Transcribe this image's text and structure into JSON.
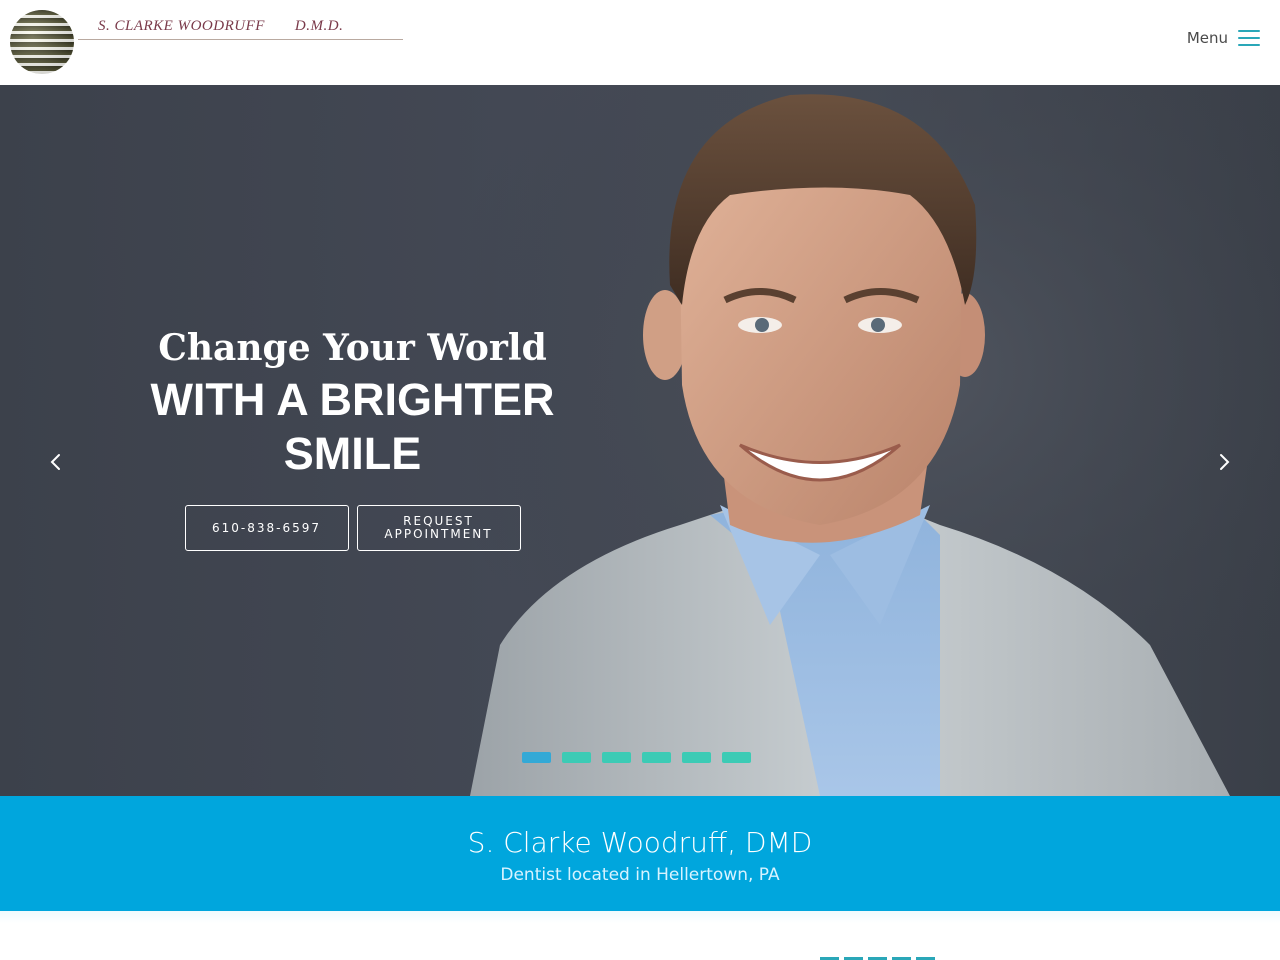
{
  "header": {
    "logo": {
      "name": "S. CLARKE WOODRUFF",
      "credential": "D.M.D.",
      "icon": "striped-globe-logo"
    },
    "menu": {
      "label": "Menu",
      "icon": "hamburger-icon",
      "accent_color": "#2aa7b8"
    }
  },
  "hero": {
    "title_line1": "Change Your World",
    "title_line2": "WITH A BRIGHTER SMILE",
    "buttons": [
      {
        "label": "610-838-6597"
      },
      {
        "label": "REQUEST APPOINTMENT"
      }
    ],
    "prev_icon": "chevron-left-icon",
    "next_icon": "chevron-right-icon",
    "slides": {
      "count": 6,
      "active_index": 0,
      "active_color": "#33a9d6",
      "inactive_color": "#3ccbb5"
    }
  },
  "banner": {
    "title": "S. Clarke Woodruff, DMD",
    "subtitle": "Dentist located in Hellertown, PA",
    "background_color": "#00a6dd"
  }
}
